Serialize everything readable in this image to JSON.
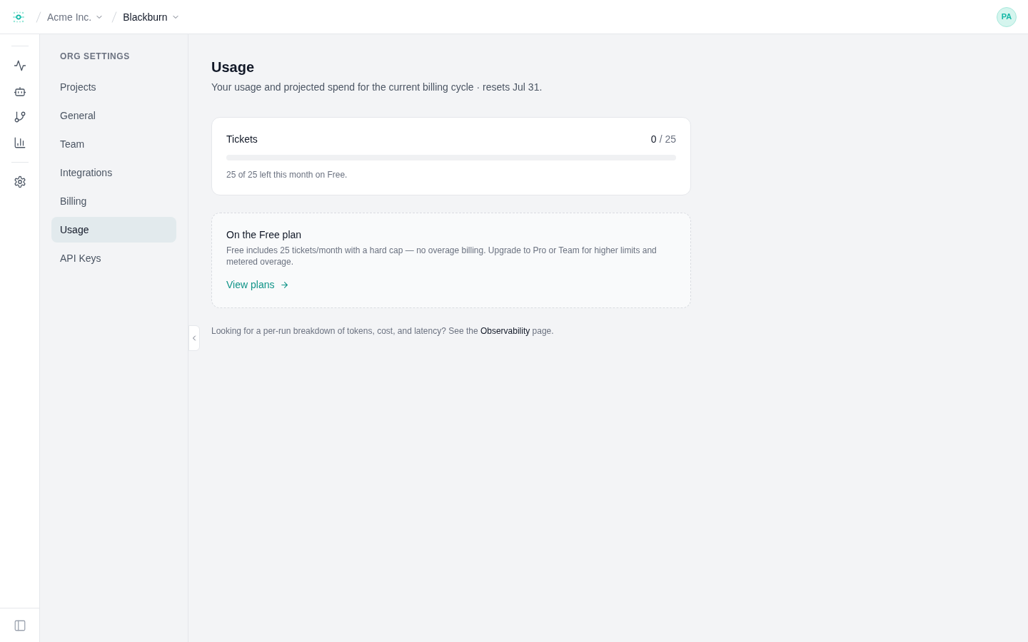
{
  "topbar": {
    "breadcrumbs": [
      {
        "label": "Acme Inc.",
        "current": false
      },
      {
        "label": "Blackburn",
        "current": true
      }
    ],
    "avatar": {
      "initials": "PA"
    }
  },
  "sidebar": {
    "heading": "ORG SETTINGS",
    "items": [
      {
        "label": "Projects",
        "selected": false
      },
      {
        "label": "General",
        "selected": false
      },
      {
        "label": "Team",
        "selected": false
      },
      {
        "label": "Integrations",
        "selected": false
      },
      {
        "label": "Billing",
        "selected": false
      },
      {
        "label": "Usage",
        "selected": true
      },
      {
        "label": "API Keys",
        "selected": false
      }
    ]
  },
  "page": {
    "title": "Usage",
    "subtitle": "Your usage and projected spend for the current billing cycle · resets Jul 31."
  },
  "usage_card": {
    "label": "Tickets",
    "used": "0",
    "limit": "/ 25",
    "level": 0,
    "note": "25 of 25 left this month on Free."
  },
  "plan_card": {
    "title": "On the Free plan",
    "description": "Free includes 25 tickets/month with a hard cap — no overage billing. Upgrade to Pro or Team for higher limits and metered overage.",
    "link": "View plans"
  },
  "footer_note": {
    "before": "Looking for a per-run breakdown of tokens, cost, and latency? See the",
    "link": "Observability",
    "after": "page."
  }
}
